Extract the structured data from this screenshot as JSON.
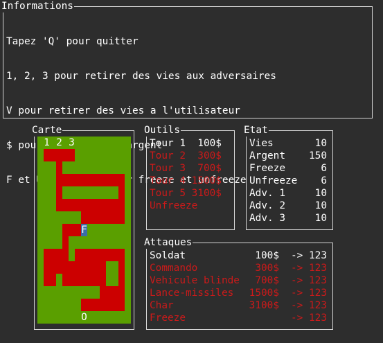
{
  "info": {
    "title": "Informations",
    "lines": [
      "Tapez 'Q' pour quitter",
      "1, 2, 3 pour retirer des vies aux adversaires",
      "V pour retirer des vies a l'utilisateur",
      "$ pour ajouter de l'argent",
      "F et U pour augmenter freeze et unfreeze"
    ]
  },
  "map": {
    "title": "Carte",
    "spawn_labels": [
      "1",
      "2",
      "3"
    ],
    "freeze_label": "F",
    "exit_label": "O",
    "colors": {
      "grass": "#5a9f00",
      "road": "#cc0000",
      "freeze": "#3a6ea8"
    }
  },
  "outils": {
    "title": "Outils",
    "items": [
      {
        "label": "Tour 1  100$",
        "color": "white"
      },
      {
        "label": "Tour 2  300$",
        "color": "red"
      },
      {
        "label": "Tour 3  700$",
        "color": "red"
      },
      {
        "label": "Tour 4 1500$",
        "color": "red"
      },
      {
        "label": "Tour 5 3100$",
        "color": "red"
      },
      {
        "label": "Unfreeze",
        "color": "red"
      }
    ]
  },
  "etat": {
    "title": "Etat",
    "rows": [
      {
        "label": "Vies",
        "value": "10"
      },
      {
        "label": "Argent",
        "value": "150"
      },
      {
        "label": "Freeze",
        "value": "6"
      },
      {
        "label": "Unfreeze",
        "value": "6"
      },
      {
        "label": "Adv. 1",
        "value": "10"
      },
      {
        "label": "Adv. 2",
        "value": "10"
      },
      {
        "label": "Adv. 3",
        "value": "10"
      }
    ]
  },
  "attaques": {
    "title": "Attaques",
    "rows": [
      {
        "name": "Soldat",
        "cost": "100$",
        "arrow": "-> 123",
        "color": "white"
      },
      {
        "name": "Commando",
        "cost": "300$",
        "arrow": "-> 123",
        "color": "red"
      },
      {
        "name": "Vehicule blinde",
        "cost": "700$",
        "arrow": "-> 123",
        "color": "red"
      },
      {
        "name": "Lance-missiles",
        "cost": "1500$",
        "arrow": "-> 123",
        "color": "red"
      },
      {
        "name": "Char",
        "cost": "3100$",
        "arrow": "-> 123",
        "color": "red"
      },
      {
        "name": "Freeze",
        "cost": "",
        "arrow": "-> 123",
        "color": "red"
      }
    ]
  }
}
